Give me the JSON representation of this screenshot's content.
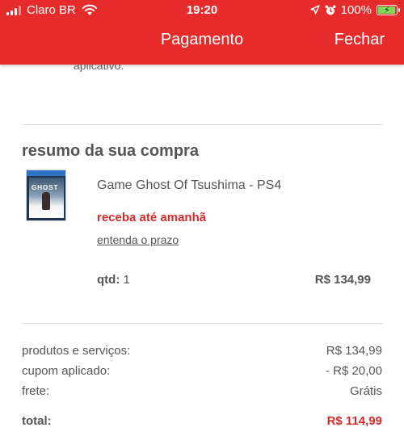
{
  "status_bar": {
    "carrier": "Claro BR",
    "time": "19:20",
    "battery": "100%",
    "icons": [
      "signal-icon",
      "wifi-icon",
      "location-icon",
      "alarm-icon",
      "battery-icon"
    ]
  },
  "nav": {
    "title": "Pagamento",
    "close_label": "Fechar"
  },
  "previous_section_tail": "aplicativo.",
  "summary": {
    "title": "resumo da sua compra",
    "product": {
      "name": "Game Ghost Of Tsushima - PS4",
      "thumbnail_brand": "PS4",
      "thumbnail_title": "GHOST",
      "delivery": "receba até amanhã",
      "delivery_link": "entenda o prazo",
      "qty_label": "qtd:",
      "qty_value": "1",
      "price": "R$ 134,99"
    }
  },
  "totals": {
    "products_label": "produtos e serviços:",
    "products_value": "R$ 134,99",
    "coupon_label": "cupom aplicado:",
    "coupon_value": "- R$ 20,00",
    "shipping_label": "frete:",
    "shipping_value": "Grátis",
    "total_label": "total:",
    "total_value": "R$ 114,99"
  },
  "colors": {
    "brand_red": "#e52b2b",
    "accent_red_text": "#d62a2a",
    "text_gray": "#555555",
    "battery_green": "#7ed957"
  }
}
